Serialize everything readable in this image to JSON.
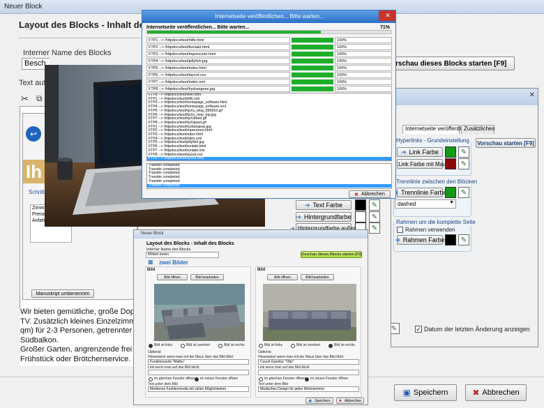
{
  "main_window": {
    "title": "Neuer Block",
    "heading": "Layout des Blocks - Inhalt des",
    "internal_name_label": "Interner Name des Blocks",
    "internal_name_value": "Besch",
    "preview_label": "rschau dieses Blocks starten [F9]",
    "text_label": "Text auf",
    "body_lines": [
      "Wir bieten gemütliche, große Dop",
      "TV. Zusätzlich kleines Einzelzimm",
      "qm) für 2-3 Personen, getrennter",
      "Südbalkon.",
      "Großer Garten, angrenzende frei",
      "Frühstück oder Brötchenservice."
    ],
    "save_label": "Speichern",
    "cancel_label": "Abbrechen"
  },
  "right_window": {
    "tab_publish": "Internetseite veröffentlichen",
    "tab_extras": "Zusätzliches",
    "preview_button": "Vorschau starten [F9]",
    "hyperlinks_group": "Hyperlinks - Grundeinstellung",
    "link_color": "Link Farbe",
    "link_color_mouse": "Link Farbe mit Maus",
    "separator_group": "Trennlinie zwischen den Blöcken",
    "separator_color": "Trennlinie Farbe",
    "separator_style": "dashed",
    "frame_group": "Rahmen um die komplette Seite",
    "use_frame": "Rahmen verwenden",
    "frame_color": "Rahmen Farbe",
    "text_color": "Text Farbe",
    "bg_color": "Hintergrundfarbe",
    "bg_color_outside": "Hintergrundfarbe außen",
    "last_change": "Datum der letzten Änderung anzeigen"
  },
  "upload_dialog": {
    "title": "Internetseite veröffentlichen... Bitte warten...",
    "status": "Internetseite veröffentlichen... Bitte warten...",
    "total_percent": "71%",
    "total_progress": 0.71,
    "transfers": [
      {
        "path": "FTP1 --> /httpdocs/test/hilfe.html",
        "pct": "100%"
      },
      {
        "path": "FTP2 --> /httpdocs/test/kontakt.html",
        "pct": "100%"
      },
      {
        "path": "FTP3 --> /httpdocs/test/impressum.html",
        "pct": "100%"
      },
      {
        "path": "FTP4 --> /httpdocs/test/jellyfish.jpg",
        "pct": "100%"
      },
      {
        "path": "FTP5 --> /httpdocs/test/index.html",
        "pct": "100%"
      },
      {
        "path": "FTP6 --> /httpdocs/test/layout.css",
        "pct": "100%"
      },
      {
        "path": "FTP7 --> /httpdocs/test/index.xml",
        "pct": "100%"
      },
      {
        "path": "FTP8 --> /httpdocs/test/hydrangeas.jpg",
        "pct": "100%"
      }
    ],
    "log": [
      "FTP8 --> /httpdocs/test/hilfe.html",
      "FTP1 --> /httpdocs/test/hilfe.xml",
      "FTP3 --> /httpdocs/test/homepage_software.html",
      "FTP4 --> /httpdocs/test/homepage_software.xml",
      "FTP5 --> /httpdocs/test/hpXs_blog_895563.gif",
      "FTP6 --> /httpdocs/test/hpXs_new_top.jpg",
      "FTP7 --> /httpdocs/test/hpXsfeed.gif",
      "FTP8 --> /httpdocs/test/hpXsjeed.gif",
      "FTP1 --> /httpdocs/test/hydrangeas.jpg",
      "FTP2 --> /httpdocs/test/impressum.html",
      "FTP3 --> /httpdocs/test/index.html",
      "FTP4 --> /httpdocs/test/index.xml",
      "FTP5 --> /httpdocs/test/jellyfish.jpg",
      "FTP6 --> /httpdocs/test/kontakt.html",
      "FTP7 --> /httpdocs/test/kontakt.xml",
      "FTP8 --> /httpdocs/test/layout.css",
      "FTP9 --> /httpdocs/test/layout.html"
    ],
    "completed": [
      "Transfer completed",
      "Transfer completed",
      "Transfer completed",
      "Transfer completed",
      "Transfer completed",
      "Transfer completed"
    ],
    "cancel_label": "Abbrechen"
  },
  "small_window": {
    "title": "Neuer Block",
    "heading": "Layout des Blocks - Inhalt des Blocks",
    "name_label": "Interner Name des Blocks",
    "name_value": "Möbel innen",
    "preview_button": "Vorschau dieses Blocks starten [F9]",
    "section_title": "zwei Bilder",
    "left": {
      "header": "Bild",
      "open": "Bild öffnen",
      "edit": "Bild bearbeiten",
      "radio_left": "Bild ist links",
      "radio_center": "Bild ist zentriert",
      "radio_right": "Bild ist rechts",
      "optional": "Optional",
      "hover_label": "Hinweistext wenn man mit der Maus über das Bild fährt",
      "hover_value": "Funktionssofa \"Malbu\"",
      "link_label": "Link wenn man auf das Bild klickt",
      "same_window": "im gleichen Fenster öffnen",
      "new_window": "im neuen Fenster öffnen",
      "caption_label": "Text unter dem Bild",
      "caption_value": "Modernes Funktionssofa mit vielen Möglichkeiten"
    },
    "right": {
      "header": "Bild",
      "open": "Bild öffnen",
      "edit": "Bild bearbeiten",
      "radio_left": "Bild ist links",
      "radio_center": "Bild ist zentriert",
      "radio_right": "Bild ist rechts",
      "optional": "Optional",
      "hover_label": "Hinweistext wenn man mit der Maus über das Bild fährt",
      "hover_value": "Couch-Garnitur \"Otto\"",
      "link_label": "Link wenn man auf das Bild klickt",
      "same_window": "im gleichen Fenster öffnen",
      "new_window": "im neuen Fenster öffnen",
      "caption_label": "Text unter dem Bild",
      "caption_value": "Modisches Design für jedes Wohnzimmer"
    },
    "save_label": "Speichern",
    "cancel_label": "Abbrechen"
  },
  "background_app": {
    "visible_text": "Ih",
    "link_label": "Schritt",
    "manage_button": "Manuskript umbenennen",
    "list_items": [
      "Zimmer",
      "Preise",
      "Anfahrt"
    ]
  },
  "colors": {
    "green": "#129a12",
    "red": "#8a0a0a",
    "black": "#000000",
    "progress": "#1fae2c",
    "selected": "#3399ff"
  }
}
